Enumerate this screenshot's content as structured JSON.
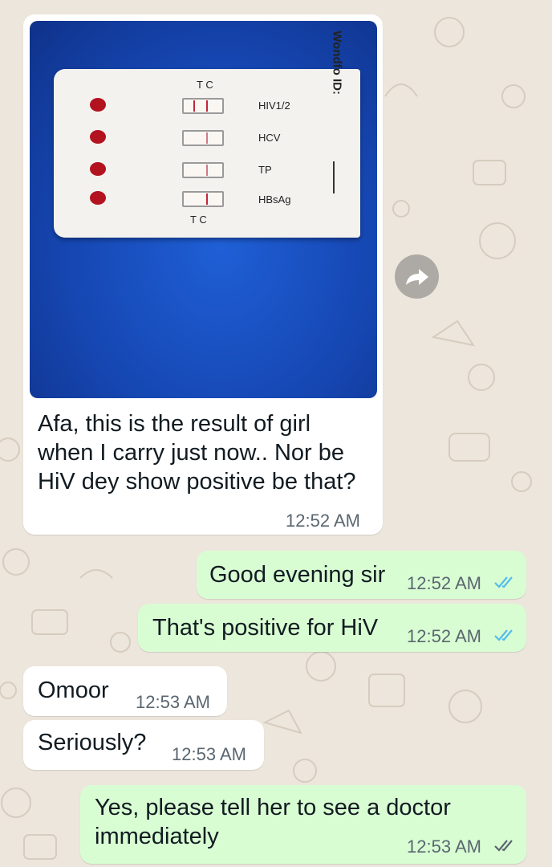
{
  "colors": {
    "background": "#ede6dc",
    "incoming_bubble": "#ffffff",
    "outgoing_bubble": "#d9fdd3",
    "read_ticks": "#53bdeb",
    "photo_background": "#1647b3"
  },
  "image_message": {
    "test_kit": {
      "brand": "Wondfo ID:",
      "top_letters": "T C",
      "bottom_letters": "T C",
      "rows": [
        {
          "label": "HIV1/2"
        },
        {
          "label": "HCV"
        },
        {
          "label": "TP"
        },
        {
          "label": "HBsAg"
        }
      ]
    },
    "caption": "Afa, this is the result of girl when I carry just now.. Nor be HiV dey show positive be that?",
    "time": "12:52 AM",
    "forward_icon": "forward-share-icon"
  },
  "messages": [
    {
      "direction": "out",
      "text": "Good evening sir",
      "time": "12:52 AM",
      "status": "read"
    },
    {
      "direction": "out",
      "text": "That's positive for HiV",
      "time": "12:52 AM",
      "status": "read"
    },
    {
      "direction": "in",
      "text": "Omoor",
      "time": "12:53 AM"
    },
    {
      "direction": "in",
      "text": "Seriously?",
      "time": "12:53 AM"
    },
    {
      "direction": "out",
      "text": "Yes, please tell her to see a doctor immediately",
      "time": "12:53 AM",
      "status": "read"
    }
  ]
}
